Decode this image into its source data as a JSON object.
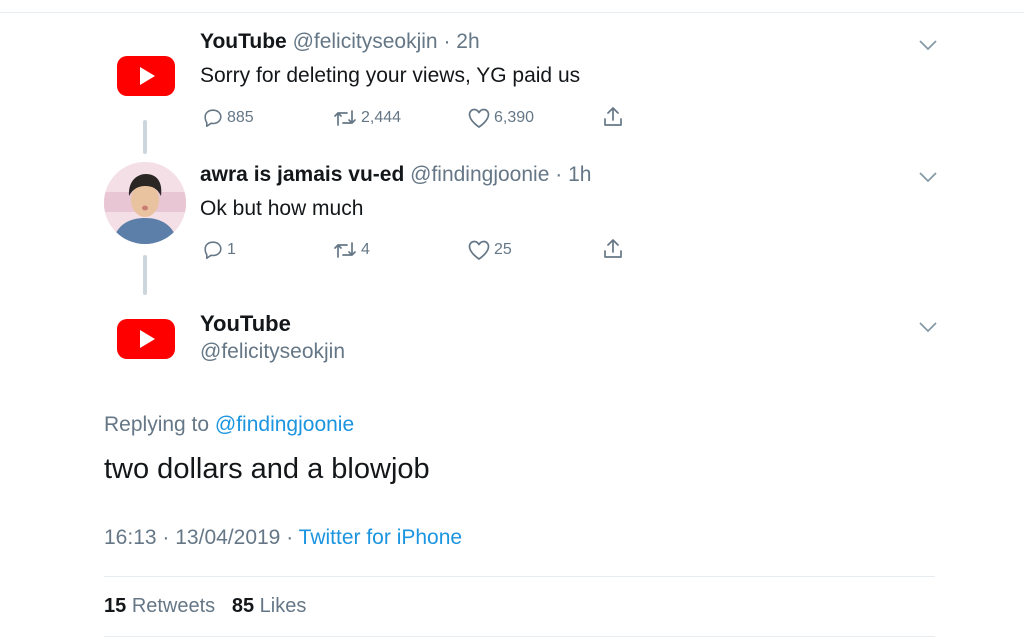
{
  "thread": [
    {
      "name": "YouTube",
      "handle": "@felicityseokjin",
      "separator": "·",
      "time": "2h",
      "text": "Sorry for deleting your views, YG paid us",
      "replies": "885",
      "retweets": "2,444",
      "likes": "6,390",
      "avatar_icon": "youtube-logo-icon"
    },
    {
      "name": "awra is jamais vu-ed",
      "handle": "@findingjoonie",
      "separator": "·",
      "time": "1h",
      "text": "Ok but how much",
      "replies": "1",
      "retweets": "4",
      "likes": "25",
      "avatar_icon": "user-avatar"
    }
  ],
  "main_tweet": {
    "name": "YouTube",
    "handle": "@felicityseokjin",
    "replying_prefix": "Replying to",
    "replying_to": "@findingjoonie",
    "text": "two dollars and a blowjob",
    "time": "16:13",
    "separator": "·",
    "date": "13/04/2019",
    "source": "Twitter for iPhone",
    "retweets_count": "15",
    "retweets_label": "Retweets",
    "likes_count": "85",
    "likes_label": "Likes"
  },
  "colors": {
    "link": "#1b95e0",
    "secondary_text": "#657786",
    "youtube_red": "#ff0000",
    "thread_line": "#ccd6dd"
  }
}
